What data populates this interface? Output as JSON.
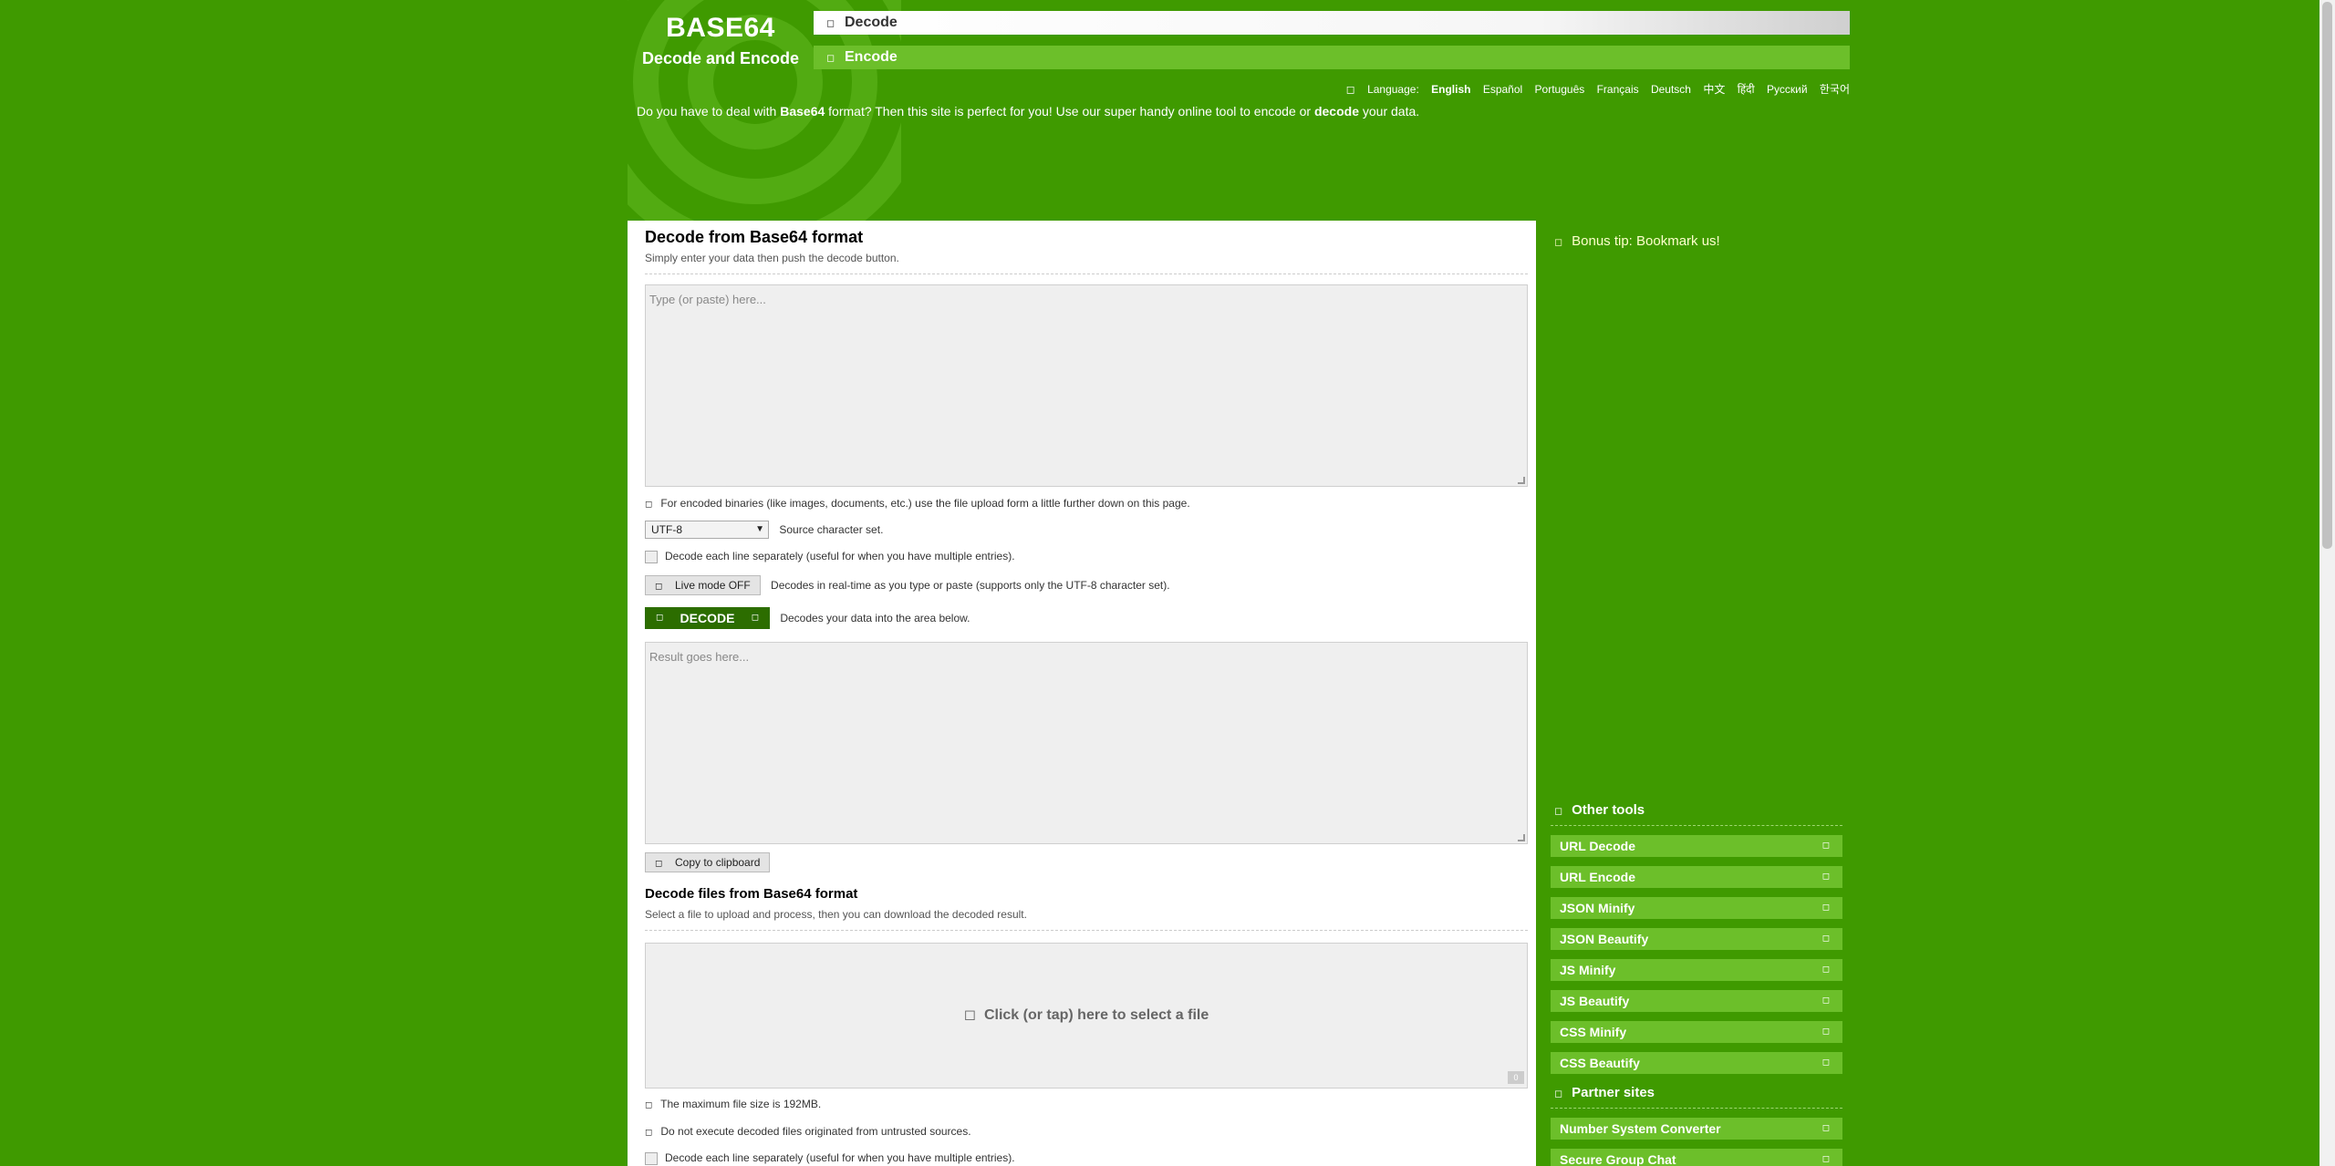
{
  "logo": {
    "title": "BASE64",
    "subtitle": "Decode and Encode"
  },
  "nav": {
    "decode": "Decode",
    "encode": "Encode"
  },
  "language": {
    "label": "Language:",
    "options": [
      "English",
      "Español",
      "Português",
      "Français",
      "Deutsch",
      "中文",
      "हिंदी",
      "Русский",
      "한국어"
    ]
  },
  "intro": {
    "part1": "Do you have to deal with ",
    "bold1": "Base64",
    "part2": " format? Then this site is perfect for you! Use our super handy online tool to encode or ",
    "bold2": "decode",
    "part3": " your data."
  },
  "decode_section": {
    "title": "Decode from Base64 format",
    "subtitle": "Simply enter your data then push the decode button.",
    "input_placeholder": "Type (or paste) here...",
    "binaries_note": "For encoded binaries (like images, documents, etc.) use the file upload form a little further down on this page.",
    "charset_value": "UTF-8",
    "charset_label": "Source character set.",
    "each_line_label": "Decode each line separately (useful for when you have multiple entries).",
    "live_mode_label": "Live mode OFF",
    "live_mode_desc": "Decodes in real-time as you type or paste (supports only the UTF-8 character set).",
    "decode_button": "DECODE",
    "decode_desc": "Decodes your data into the area below.",
    "result_placeholder": "Result goes here...",
    "copy_button": "Copy to clipboard"
  },
  "files_section": {
    "title": "Decode files from Base64 format",
    "subtitle": "Select a file to upload and process, then you can download the decoded result.",
    "upload_label": "Click (or tap) here to select a file",
    "max_size": "The maximum file size is 192MB.",
    "warning": "Do not execute decoded files originated from untrusted sources.",
    "each_line_label": "Decode each line separately (useful for when you have multiple entries)."
  },
  "sidebar": {
    "bonus": "Bonus tip: Bookmark us!",
    "other_tools_title": "Other tools",
    "other_tools": [
      "URL Decode",
      "URL Encode",
      "JSON Minify",
      "JSON Beautify",
      "JS Minify",
      "JS Beautify",
      "CSS Minify",
      "CSS Beautify"
    ],
    "partner_title": "Partner sites",
    "partners": [
      "Number System Converter",
      "Secure Group Chat"
    ]
  },
  "colors": {
    "background": "#3f9a00",
    "accent": "#6cbf2a",
    "button_dark": "#2c6d00"
  }
}
